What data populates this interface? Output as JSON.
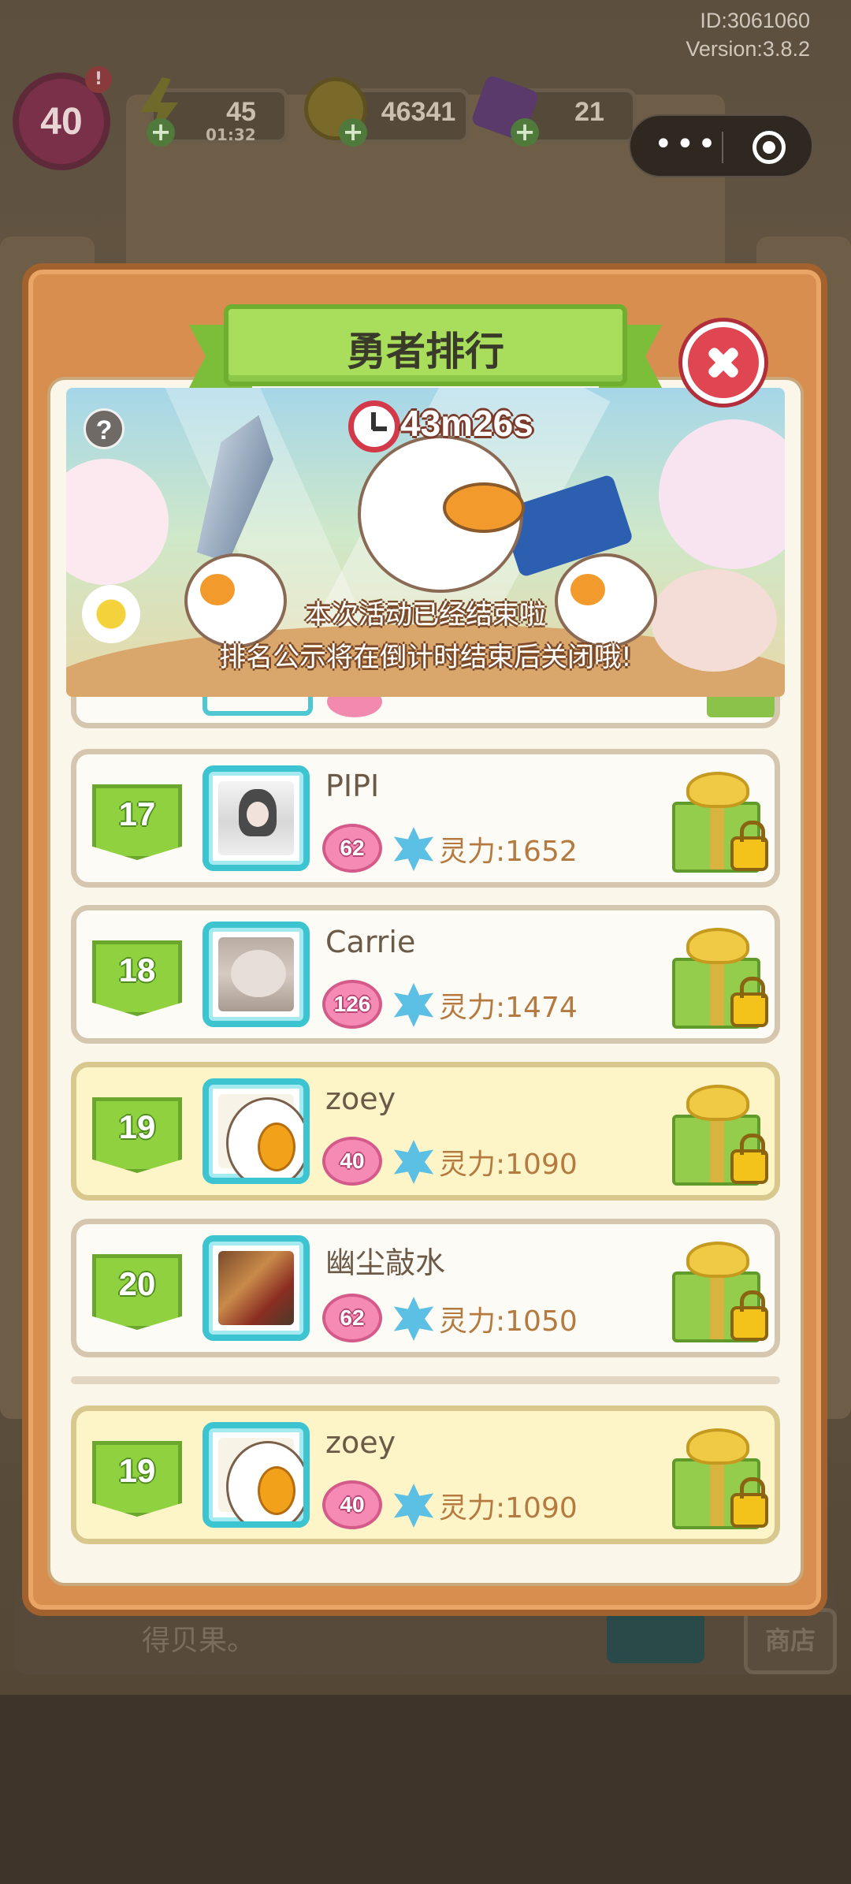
{
  "app": {
    "id_text": "ID:3061060",
    "version_text": "Version:3.8.2"
  },
  "hud": {
    "level": "40",
    "level_alert": "!",
    "energy": "45",
    "energy_timer": "01:32",
    "coins": "46341",
    "gems": "21",
    "more_icon": "•••"
  },
  "modal": {
    "title": "勇者排行",
    "countdown": "43m26s",
    "help_icon": "?",
    "message_line1": "本次活动已经结束啦",
    "message_line2": "排名公示将在倒计时结束后关闭哦!"
  },
  "rankings": [
    {
      "rank": "17",
      "name": "PIPI",
      "level": "62",
      "power": "灵力:1652",
      "avatar": "girl",
      "is_self": false
    },
    {
      "rank": "18",
      "name": "Carrie",
      "level": "126",
      "power": "灵力:1474",
      "avatar": "cat",
      "is_self": false
    },
    {
      "rank": "19",
      "name": "zoey",
      "level": "40",
      "power": "灵力:1090",
      "avatar": "duck",
      "is_self": true
    },
    {
      "rank": "20",
      "name": "幽尘敲水",
      "level": "62",
      "power": "灵力:1050",
      "avatar": "couple",
      "is_self": false
    }
  ],
  "my_rank": {
    "rank": "19",
    "name": "zoey",
    "level": "40",
    "power": "灵力:1090"
  },
  "background": {
    "hint_text": "得贝果。",
    "shop_label": "商店"
  },
  "colors": {
    "ribbon_green": "#a8de5c",
    "close_red": "#e04552",
    "avatar_frame": "#3cc4d0",
    "self_row": "#fdf5c8",
    "panel_orange": "#d88e4e"
  }
}
